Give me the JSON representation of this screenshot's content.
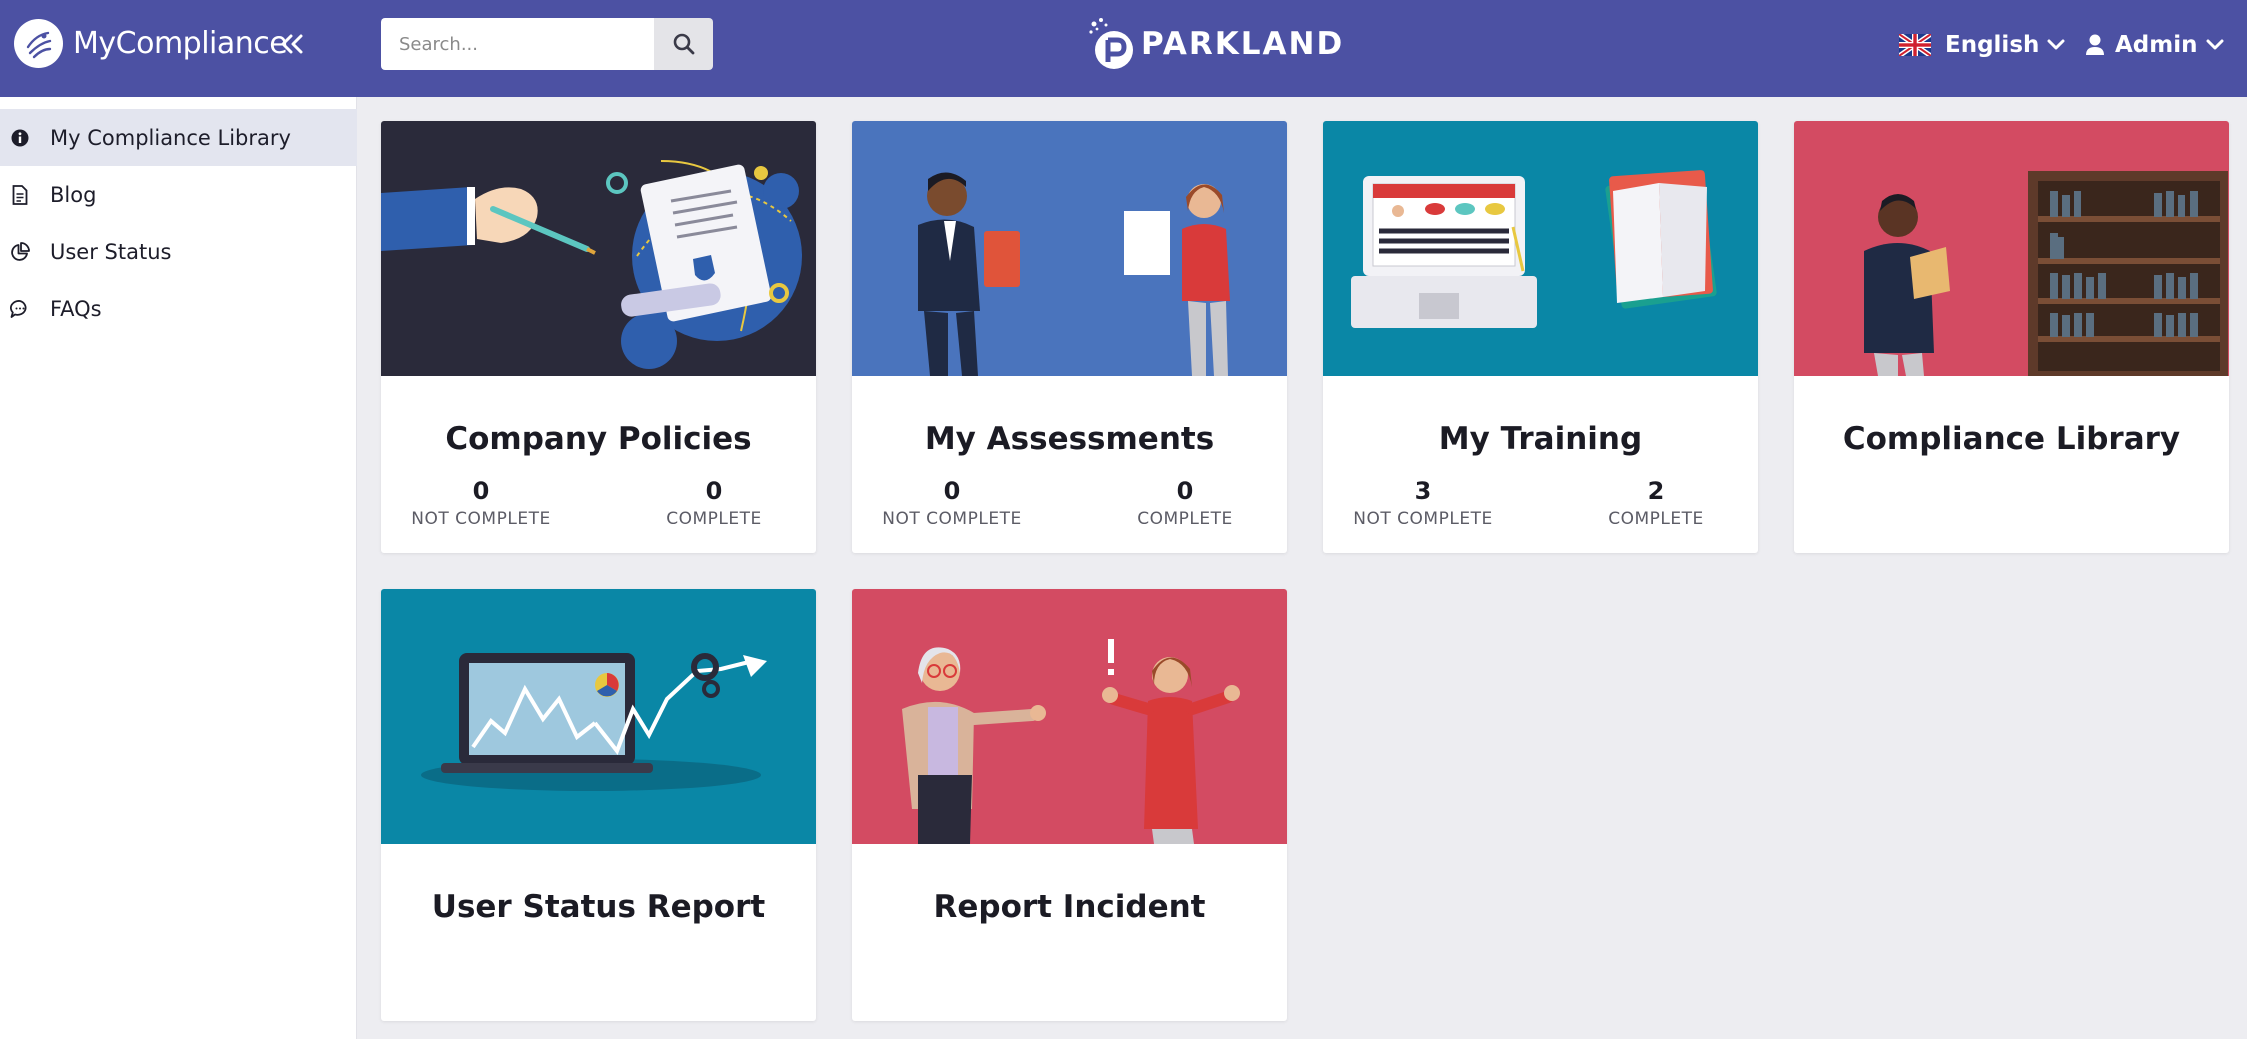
{
  "header": {
    "brand_name": "MyCompliance",
    "logo_text": "PARKLAND",
    "search_placeholder": "Search...",
    "language": "English",
    "user": "Admin",
    "colors": {
      "bar": "#4c51a3",
      "text": "#ffffff"
    }
  },
  "sidebar": {
    "items": [
      {
        "label": "My Compliance Library",
        "icon": "info-circle-icon",
        "active": true
      },
      {
        "label": "Blog",
        "icon": "document-icon",
        "active": false
      },
      {
        "label": "User Status",
        "icon": "pie-chart-icon",
        "active": false
      },
      {
        "label": "FAQs",
        "icon": "chat-bubble-icon",
        "active": false
      }
    ]
  },
  "cards": [
    {
      "title": "Company Policies",
      "stats": [
        {
          "value": "0",
          "label": "NOT COMPLETE"
        },
        {
          "value": "0",
          "label": "COMPLETE"
        }
      ],
      "color": "#2a2a3a"
    },
    {
      "title": "My Assessments",
      "stats": [
        {
          "value": "0",
          "label": "NOT COMPLETE"
        },
        {
          "value": "0",
          "label": "COMPLETE"
        }
      ],
      "color": "#4a74bd"
    },
    {
      "title": "My Training",
      "stats": [
        {
          "value": "3",
          "label": "NOT COMPLETE"
        },
        {
          "value": "2",
          "label": "COMPLETE"
        }
      ],
      "color": "#0a87a6"
    },
    {
      "title": "Compliance Library",
      "color": "#d34b62"
    },
    {
      "title": "User Status Report",
      "color": "#0a87a6"
    },
    {
      "title": "Report Incident",
      "color": "#d34b62"
    }
  ]
}
